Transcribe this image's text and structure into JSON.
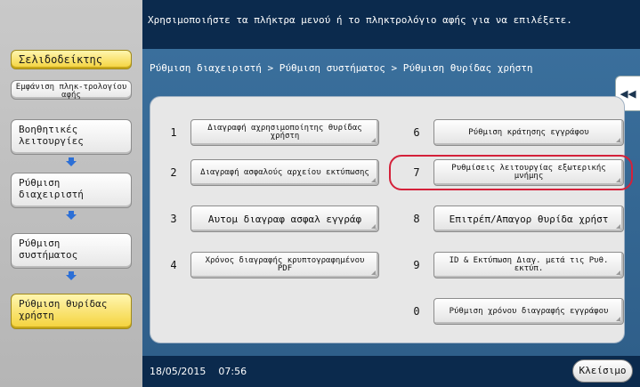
{
  "top_message": "Χρησιμοποιήστε τα πλήκτρα μενού ή το πληκτρολόγιο αφής για να επιλέξετε.",
  "breadcrumb": "Ρύθμιση διαχειριστή > Ρύθμιση συστήματος > Ρύθμιση θυρίδας χρήστη",
  "sidebar": {
    "bookmark": "Σελιδοδείκτης",
    "keypad": "Εμφάνιση πληκ-τρολογίου αφής",
    "utility": "Βοηθητικές λειτουργίες",
    "admin": "Ρύθμιση διαχειριστή",
    "system": "Ρύθμιση συστήματος",
    "user_box": "Ρύθμιση θυρίδας χρήστη"
  },
  "options": [
    {
      "num": "1",
      "label": "Διαγραφή αχρησιμοποίητης θυρίδας χρήστη"
    },
    {
      "num": "2",
      "label": "Διαγραφή ασφαλούς αρχείου εκτύπωσης"
    },
    {
      "num": "3",
      "label": "Αυτομ διαγραφ ασφαλ εγγράφ"
    },
    {
      "num": "4",
      "label": "Χρόνος διαγραφής κρυπτογραφημένου PDF"
    },
    {
      "num": "6",
      "label": "Ρύθμιση κράτησης εγγράφου"
    },
    {
      "num": "7",
      "label": "Ρυθμίσεις λειτουργίας εξωτερικής μνήμης"
    },
    {
      "num": "8",
      "label": "Επιτρέπ/Απαγορ θυρίδα χρήστ"
    },
    {
      "num": "9",
      "label": "ID & Εκτύπωση Διαγ. μετά τις Ρυθ. εκτύπ."
    },
    {
      "num": "0",
      "label": "Ρύθμιση χρόνου διαγραφής εγγράφου"
    }
  ],
  "date": "18/05/2015",
  "time": "07:56",
  "close_label": "Κλείσιμο",
  "collapse_glyph": "◀◀",
  "colors": {
    "title_bar": "#0b2a4d",
    "panel": "#3a6f9c",
    "highlight": "#d4213a",
    "active": "#f4d23a"
  }
}
